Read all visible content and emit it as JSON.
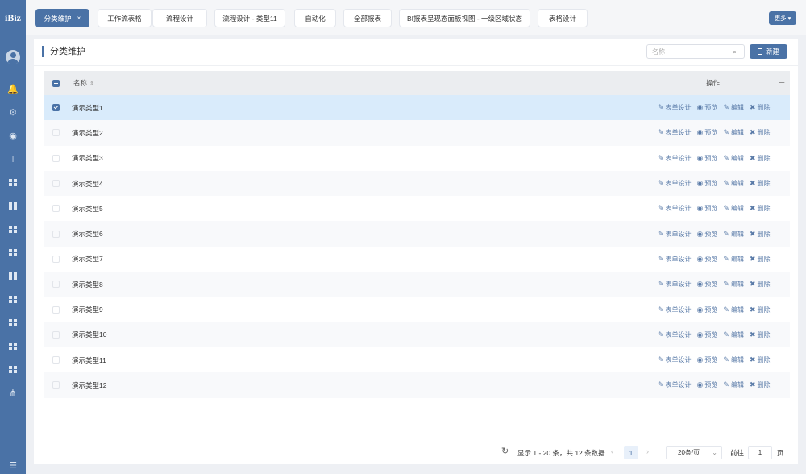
{
  "app": {
    "logo": "iBiz"
  },
  "sidebar": {
    "icons": [
      "bell-icon",
      "gear-icon",
      "globe-icon",
      "paint-roller-icon",
      "grid-icon",
      "grid-icon",
      "grid-icon",
      "grid-icon",
      "grid-icon",
      "grid-icon",
      "grid-icon",
      "grid-icon",
      "grid-icon",
      "tree-icon"
    ],
    "bottom_icon": "menu-fold-icon"
  },
  "tabs": [
    {
      "label": "分类维护",
      "active": true,
      "closable": true
    },
    {
      "label": "工作流表格"
    },
    {
      "label": "流程设计"
    },
    {
      "label": "流程设计 - 类型11"
    },
    {
      "label": "自动化"
    },
    {
      "label": "全部报表"
    },
    {
      "label": "BI报表呈现态面板视图 - 一级区域状态"
    },
    {
      "label": "表格设计"
    }
  ],
  "more_label": "更多 ▾",
  "page": {
    "title": "分类维护",
    "search_placeholder": "名称",
    "new_label": "新建"
  },
  "table": {
    "header": {
      "name": "名称",
      "ops": "操作"
    },
    "ops": [
      {
        "label": "表单设计",
        "icon": "edit-icon"
      },
      {
        "label": "预览",
        "icon": "eye-icon"
      },
      {
        "label": "编辑",
        "icon": "edit-icon"
      },
      {
        "label": "删除",
        "icon": "close-icon"
      }
    ],
    "rows": [
      {
        "name": "演示类型1",
        "selected": true
      },
      {
        "name": "演示类型2"
      },
      {
        "name": "演示类型3"
      },
      {
        "name": "演示类型4"
      },
      {
        "name": "演示类型5"
      },
      {
        "name": "演示类型6"
      },
      {
        "name": "演示类型7"
      },
      {
        "name": "演示类型8"
      },
      {
        "name": "演示类型9"
      },
      {
        "name": "演示类型10"
      },
      {
        "name": "演示类型11"
      },
      {
        "name": "演示类型12"
      }
    ]
  },
  "pagination": {
    "info": "显示 1 - 20 条，共 12 条数据",
    "current_page": "1",
    "page_size": "20条/页",
    "goto_label": "前往",
    "goto_value": "1",
    "page_unit": "页"
  },
  "colors": {
    "brand": "#4a72a6",
    "selected_row": "#d9ebfb",
    "header_bg": "#ebedf0"
  }
}
